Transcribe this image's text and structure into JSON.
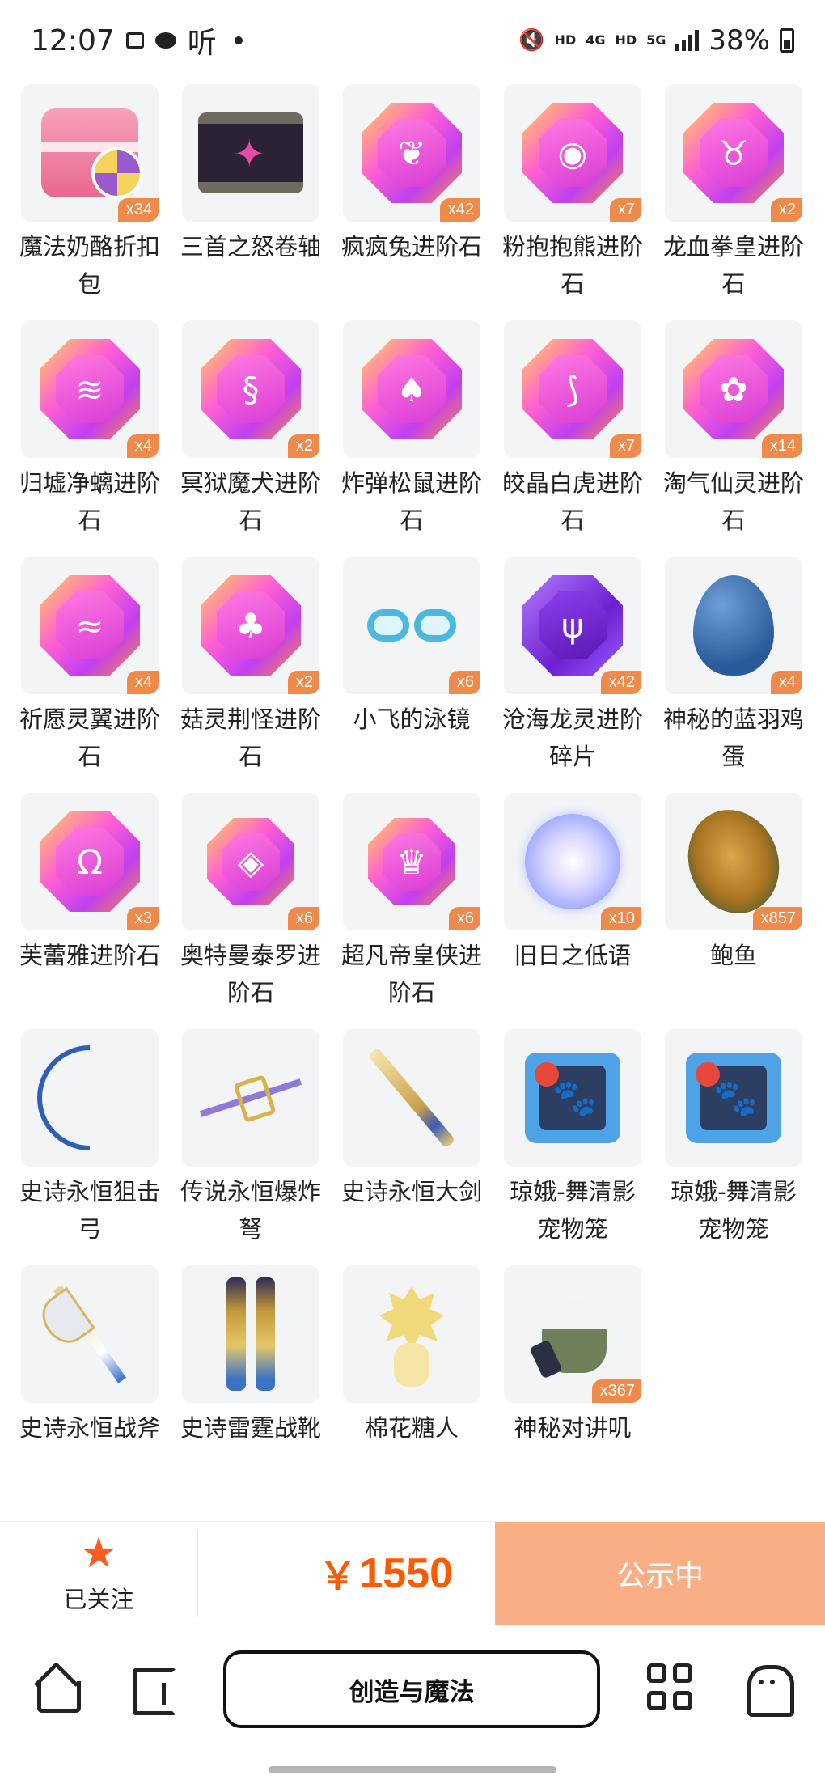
{
  "status_bar": {
    "time": "12:07",
    "left_icons": [
      "image-icon",
      "wechat-icon",
      "ting-app-icon"
    ],
    "ting_label": "听",
    "net1": "HD",
    "net2": "4G",
    "net3": "HD",
    "net4": "5G",
    "battery": "38%"
  },
  "items": [
    {
      "name": "魔法奶酪折扣包",
      "count": "x34",
      "icon": "gift-box-icon"
    },
    {
      "name": "三首之怒卷轴",
      "count": "",
      "icon": "scroll-icon"
    },
    {
      "name": "疯疯兔进阶石",
      "count": "x42",
      "icon": "carrot-gem-icon"
    },
    {
      "name": "粉抱抱熊进阶石",
      "count": "x7",
      "icon": "egg-gem-icon"
    },
    {
      "name": "龙血拳皇进阶石",
      "count": "x2",
      "icon": "bull-gem-icon"
    },
    {
      "name": "归墟净螭进阶石",
      "count": "x4",
      "icon": "wing-gem-icon"
    },
    {
      "name": "冥狱魔犬进阶石",
      "count": "x2",
      "icon": "flame-gem-icon"
    },
    {
      "name": "炸弹松鼠进阶石",
      "count": "",
      "icon": "acorn-gem-icon"
    },
    {
      "name": "皎晶白虎进阶石",
      "count": "x7",
      "icon": "claw-gem-icon"
    },
    {
      "name": "淘气仙灵进阶石",
      "count": "x14",
      "icon": "fairy-gem-icon"
    },
    {
      "name": "祈愿灵翼进阶石",
      "count": "x4",
      "icon": "feather-gem-icon"
    },
    {
      "name": "菇灵荆怪进阶石",
      "count": "x2",
      "icon": "mushroom-gem-icon"
    },
    {
      "name": "小飞的泳镜",
      "count": "x6",
      "icon": "goggles-icon"
    },
    {
      "name": "沧海龙灵进阶碎片",
      "count": "x42",
      "icon": "purple-gem-icon"
    },
    {
      "name": "神秘的蓝羽鸡蛋",
      "count": "x4",
      "icon": "blue-egg-icon"
    },
    {
      "name": "芙蕾雅进阶石",
      "count": "x3",
      "icon": "horns-gem-icon"
    },
    {
      "name": "奥特曼泰罗进阶石",
      "count": "x6",
      "icon": "ultraman-gem-icon"
    },
    {
      "name": "超凡帝皇侠进阶石",
      "count": "x6",
      "icon": "crown-gem-icon"
    },
    {
      "name": "旧日之低语",
      "count": "x10",
      "icon": "orb-icon"
    },
    {
      "name": "鲍鱼",
      "count": "x857",
      "icon": "abalone-icon"
    },
    {
      "name": "史诗永恒狙击弓",
      "count": "",
      "icon": "bow-icon"
    },
    {
      "name": "传说永恒爆炸弩",
      "count": "",
      "icon": "crossbow-icon"
    },
    {
      "name": "史诗永恒大剑",
      "count": "",
      "icon": "greatsword-icon"
    },
    {
      "name": "琼娥-舞清影宠物笼",
      "count": "",
      "icon": "pet-cage-icon"
    },
    {
      "name": "琼娥-舞清影宠物笼",
      "count": "",
      "icon": "pet-cage-icon"
    },
    {
      "name": "史诗永恒战斧",
      "count": "",
      "icon": "battle-axe-icon"
    },
    {
      "name": "史诗雷霆战靴",
      "count": "",
      "icon": "boots-icon"
    },
    {
      "name": "棉花糖人",
      "count": "",
      "icon": "marshmallow-icon"
    },
    {
      "name": "神秘对讲叽",
      "count": "x367",
      "icon": "walkie-bird-icon"
    }
  ],
  "action_bar": {
    "follow_label": "已关注",
    "currency": "￥",
    "price": "1550",
    "notice_label": "公示中",
    "price_color": "#ff5a00",
    "notice_color": "#f9ae86"
  },
  "nav": {
    "center_label": "创造与魔法",
    "icons": [
      "home-icon",
      "page-icon",
      "grid-icon",
      "ghost-icon"
    ]
  }
}
